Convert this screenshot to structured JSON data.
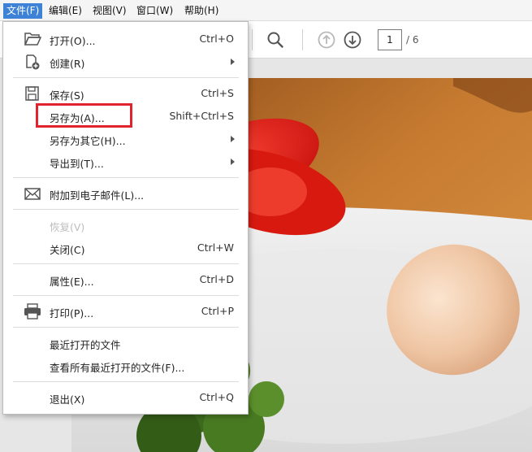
{
  "menubar": {
    "items": [
      {
        "label": "文件(F)",
        "active": true
      },
      {
        "label": "编辑(E)"
      },
      {
        "label": "视图(V)"
      },
      {
        "label": "窗口(W)"
      },
      {
        "label": "帮助(H)"
      }
    ]
  },
  "toolbar": {
    "page_current": "1",
    "page_total": "/ 6",
    "icons": [
      "search-icon",
      "page-up-icon",
      "page-down-icon"
    ]
  },
  "file_menu": {
    "open": {
      "label": "打开(O)...",
      "shortcut": "Ctrl+O"
    },
    "create": {
      "label": "创建(R)"
    },
    "save": {
      "label": "保存(S)",
      "shortcut": "Ctrl+S"
    },
    "save_as": {
      "label": "另存为(A)...",
      "shortcut": "Shift+Ctrl+S"
    },
    "save_as_other": {
      "label": "另存为其它(H)..."
    },
    "export_to": {
      "label": "导出到(T)..."
    },
    "attach_email": {
      "label": "附加到电子邮件(L)..."
    },
    "revert": {
      "label": "恢复(V)",
      "disabled": true
    },
    "close": {
      "label": "关闭(C)",
      "shortcut": "Ctrl+W"
    },
    "properties": {
      "label": "属性(E)...",
      "shortcut": "Ctrl+D"
    },
    "print": {
      "label": "打印(P)...",
      "shortcut": "Ctrl+P"
    },
    "recent": {
      "label": "最近打开的文件"
    },
    "view_all_recent": {
      "label": "查看所有最近打开的文件(F)..."
    },
    "exit": {
      "label": "退出(X)",
      "shortcut": "Ctrl+Q"
    }
  },
  "colors": {
    "menu_active": "#3e82d8",
    "highlight": "#e0232c"
  }
}
